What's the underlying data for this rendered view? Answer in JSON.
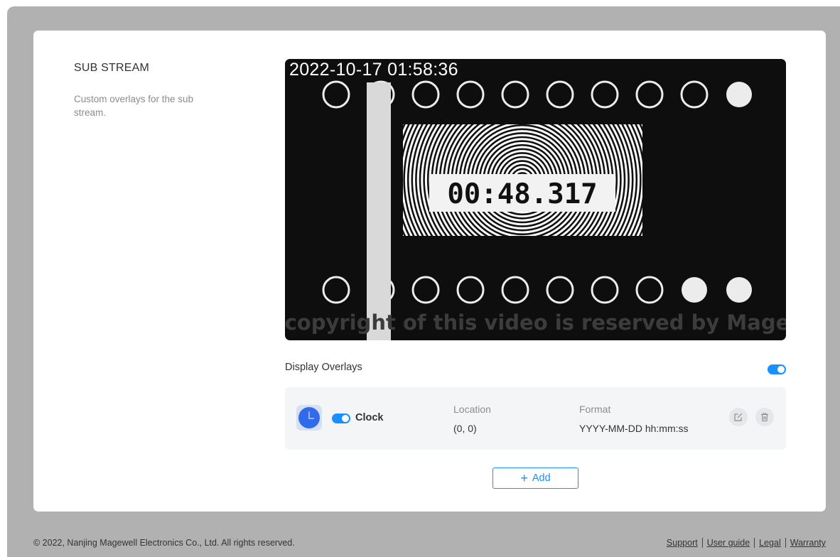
{
  "section": {
    "title": "SUB STREAM",
    "description": "Custom overlays for the sub stream."
  },
  "preview": {
    "timestamp": "2022-10-17 01:58:36",
    "timer": "00:48.317",
    "copyright_text": "The copyright of this video is reserved by Magewell"
  },
  "display_overlays": {
    "label": "Display Overlays",
    "enabled": true
  },
  "overlays": [
    {
      "icon": "clock-icon",
      "enabled": true,
      "name": "Clock",
      "location_label": "Location",
      "location_value": "(0, 0)",
      "format_label": "Format",
      "format_value": "YYYY-MM-DD hh:mm:ss"
    }
  ],
  "actions": {
    "add_label": "Add"
  },
  "footer": {
    "copyright": "© 2022, Nanjing Magewell Electronics Co., Ltd. All rights reserved.",
    "links": [
      "Support",
      "User guide",
      "Legal",
      "Warranty"
    ]
  },
  "colors": {
    "accent": "#1890ff",
    "backdrop": "#b1b1b1",
    "video_bg": "#0e0e0e"
  }
}
